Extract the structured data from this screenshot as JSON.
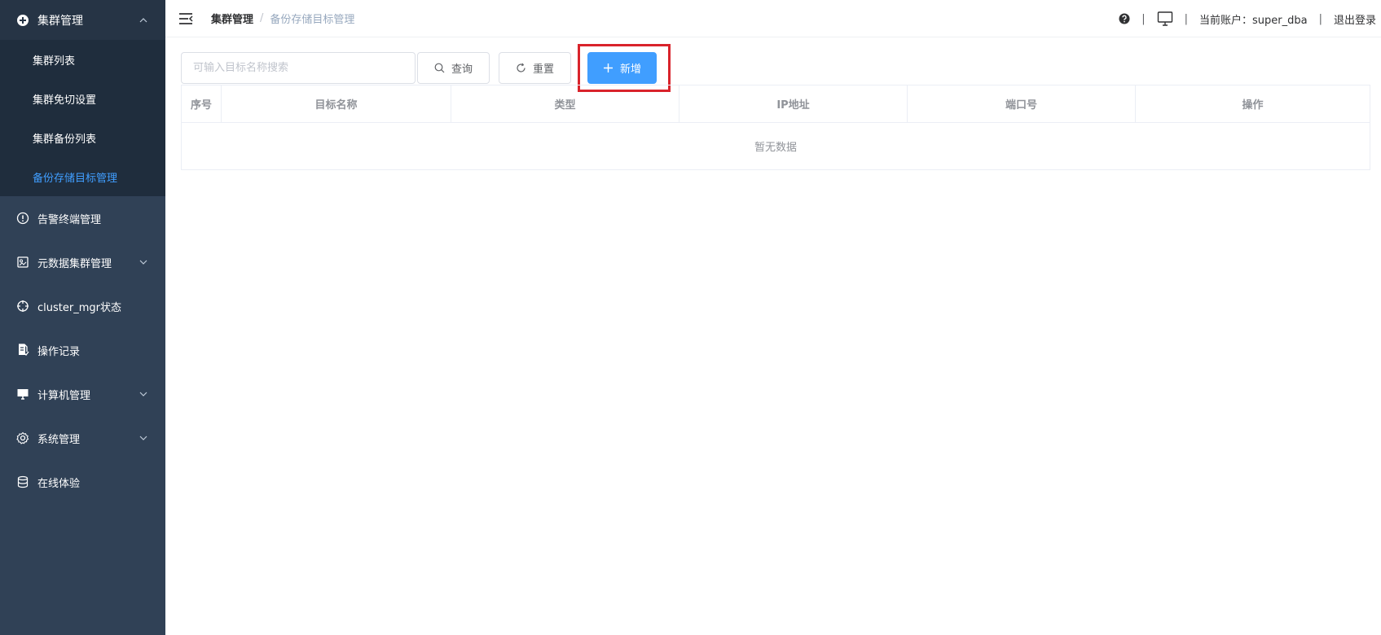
{
  "sidebar": {
    "group": {
      "label": "集群管理",
      "icon": "cluster-icon"
    },
    "subitems": [
      {
        "label": "集群列表"
      },
      {
        "label": "集群免切设置"
      },
      {
        "label": "集群备份列表"
      },
      {
        "label": "备份存储目标管理",
        "active": true
      }
    ],
    "items": [
      {
        "label": "告警终端管理",
        "icon": "alert-icon"
      },
      {
        "label": "元数据集群管理",
        "icon": "metadata-icon",
        "has_children": true
      },
      {
        "label": "cluster_mgr状态",
        "icon": "crosshair-icon"
      },
      {
        "label": "操作记录",
        "icon": "record-icon"
      },
      {
        "label": "计算机管理",
        "icon": "computer-icon",
        "has_children": true
      },
      {
        "label": "系统管理",
        "icon": "gear-icon",
        "has_children": true
      },
      {
        "label": "在线体验",
        "icon": "database-icon"
      }
    ]
  },
  "navbar": {
    "breadcrumb": [
      "集群管理",
      "备份存储目标管理"
    ],
    "breadcrumb_separator": "/",
    "separator": "|",
    "account_label": "当前账户：super_dba",
    "logout": "退出登录"
  },
  "toolbar": {
    "search_placeholder": "可输入目标名称搜索",
    "search_value": "",
    "query_label": "查询",
    "reset_label": "重置",
    "add_label": "新增"
  },
  "table": {
    "columns": [
      "序号",
      "目标名称",
      "类型",
      "IP地址",
      "端口号",
      "操作"
    ],
    "rows": [],
    "empty_text": "暂无数据"
  },
  "colors": {
    "sidebar_bg": "#304156",
    "submenu_bg": "#1f2d3d",
    "active": "#409eff",
    "primary": "#409eff",
    "highlight": "#d9232b"
  }
}
